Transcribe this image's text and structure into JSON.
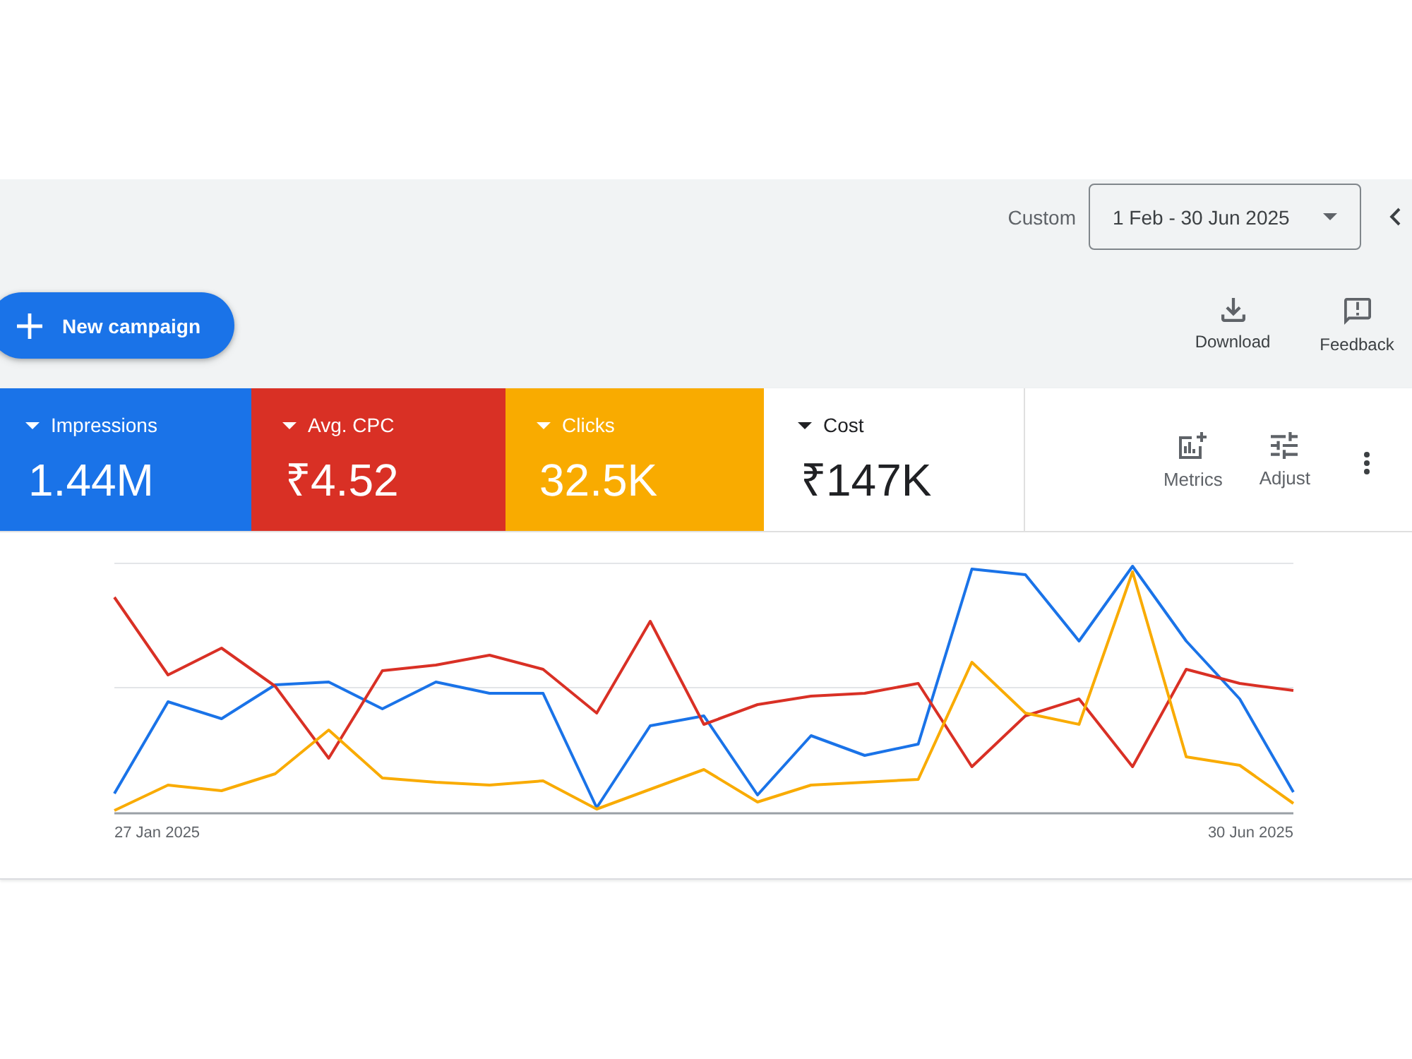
{
  "toolbar": {
    "date_range_label": "Custom",
    "date_range": "1 Feb - 30 Jun 2025"
  },
  "new_campaign_button": {
    "label": "New campaign"
  },
  "actions": [
    {
      "kind": "download",
      "label": "Download"
    },
    {
      "kind": "feedback",
      "label": "Feedback"
    }
  ],
  "metrics": [
    {
      "name": "Impressions",
      "value": "1.44M",
      "selected": true,
      "color": "#1a73e8"
    },
    {
      "name": "Avg. CPC",
      "value": "₹4.52",
      "selected": true,
      "color": "#d93025"
    },
    {
      "name": "Clicks",
      "value": "32.5K",
      "selected": true,
      "color": "#f9ab00"
    },
    {
      "name": "Cost",
      "value": "₹147K",
      "selected": false
    }
  ],
  "chart_tools": [
    {
      "kind": "metrics",
      "label": "Metrics"
    },
    {
      "kind": "adjust",
      "label": "Adjust"
    },
    {
      "kind": "more"
    }
  ],
  "chart": {
    "x_labels": [
      "27 Jan 2025",
      "30 Jun 2025"
    ]
  }
}
